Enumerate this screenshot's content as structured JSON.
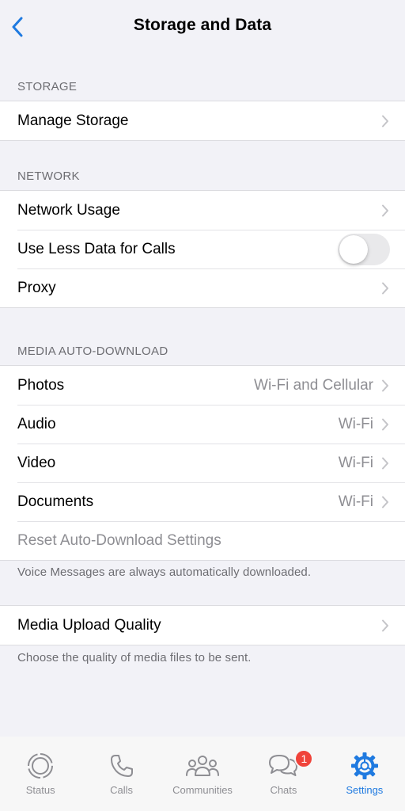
{
  "nav": {
    "title": "Storage and Data"
  },
  "storage": {
    "header": "STORAGE",
    "manage_storage": "Manage Storage"
  },
  "network": {
    "header": "NETWORK",
    "network_usage": "Network Usage",
    "use_less_data": "Use Less Data for Calls",
    "use_less_data_enabled": false,
    "proxy": "Proxy"
  },
  "media": {
    "header": "MEDIA AUTO-DOWNLOAD",
    "rows": [
      {
        "label": "Photos",
        "value": "Wi-Fi and Cellular"
      },
      {
        "label": "Audio",
        "value": "Wi-Fi"
      },
      {
        "label": "Video",
        "value": "Wi-Fi"
      },
      {
        "label": "Documents",
        "value": "Wi-Fi"
      }
    ],
    "reset": "Reset Auto-Download Settings",
    "note": "Voice Messages are always automatically downloaded."
  },
  "upload": {
    "label": "Media Upload Quality",
    "note": "Choose the quality of media files to be sent."
  },
  "tabbar": {
    "tabs": [
      {
        "label": "Status",
        "icon": "status-icon"
      },
      {
        "label": "Calls",
        "icon": "phone-icon"
      },
      {
        "label": "Communities",
        "icon": "communities-icon"
      },
      {
        "label": "Chats",
        "icon": "chat-bubbles-icon",
        "badge": "1"
      },
      {
        "label": "Settings",
        "icon": "gear-icon",
        "active": true
      }
    ]
  },
  "colors": {
    "accent": "#1f7ae0",
    "badge": "#f0433a",
    "background": "#f2f2f7",
    "secondary_text": "#8e8e93"
  }
}
